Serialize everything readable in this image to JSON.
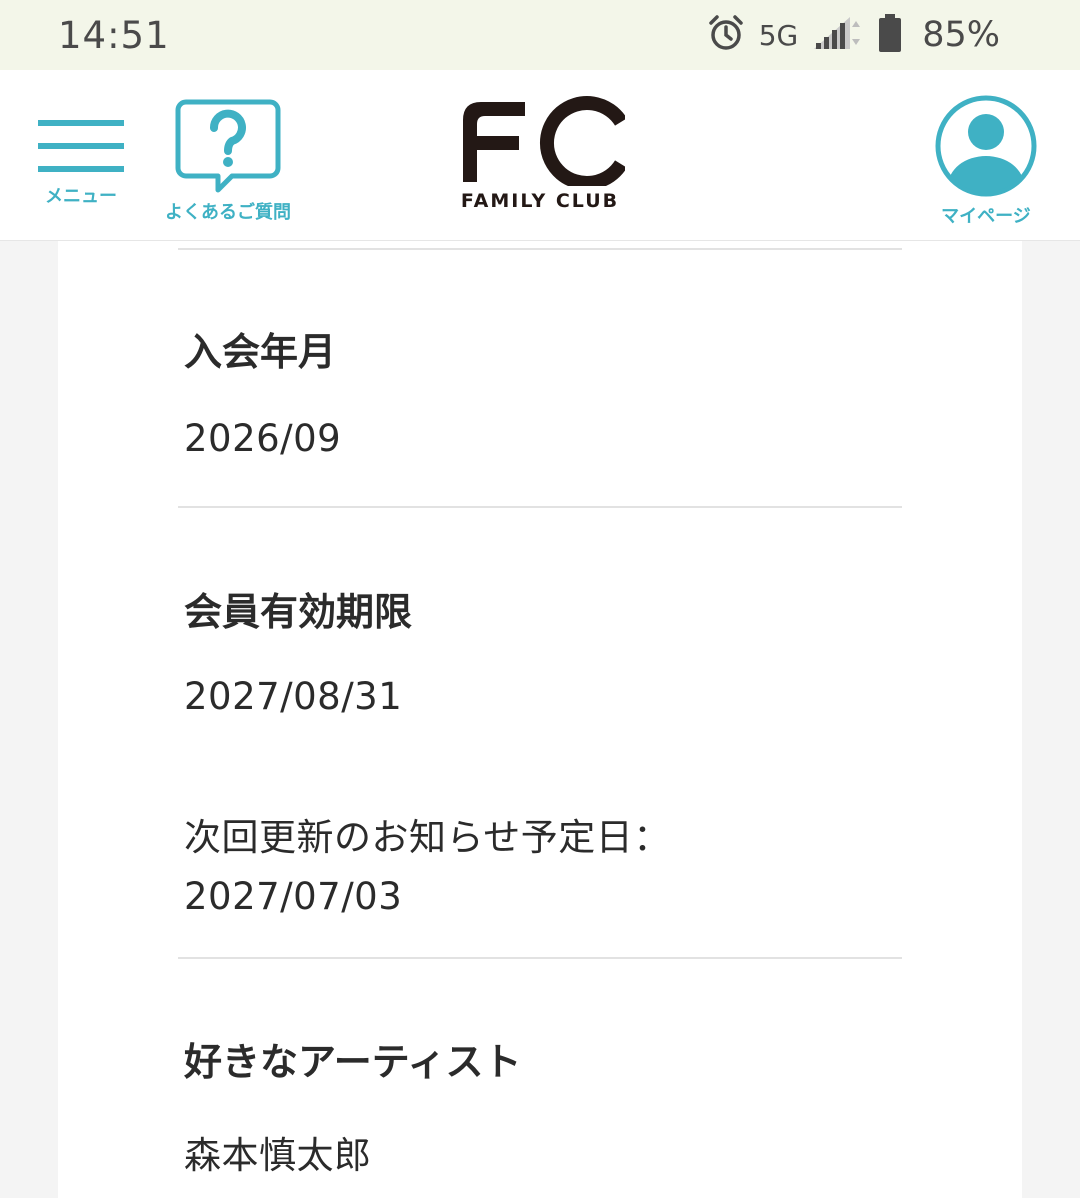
{
  "status_bar": {
    "time": "14:51",
    "network": "5G",
    "battery": "85%",
    "icons": [
      "alarm-icon",
      "signal-icon",
      "battery-icon"
    ]
  },
  "header": {
    "menu_label": "メニュー",
    "faq_label": "よくあるご質問",
    "logo_text": "FC",
    "logo_subtitle": "FAMILY CLUB",
    "mypage_label": "マイページ",
    "accent_color": "#3fb1c4"
  },
  "profile": {
    "join_date": {
      "label": "入会年月",
      "value": "2026/09"
    },
    "expiry": {
      "label": "会員有効期限",
      "value": "2027/08/31",
      "renewal_notice_label": "次回更新のお知らせ予定日：",
      "renewal_notice_value": "2027/07/03"
    },
    "favorite_artist": {
      "label": "好きなアーティスト",
      "value": "森本慎太郎"
    }
  }
}
